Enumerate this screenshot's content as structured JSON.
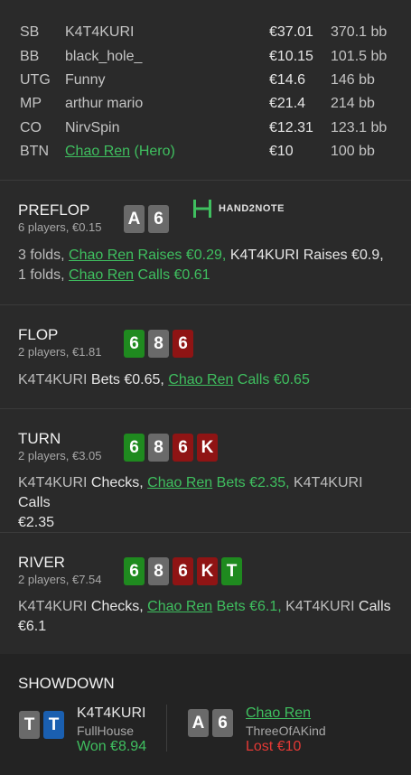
{
  "players": [
    {
      "pos": "SB",
      "name": "K4T4KURI",
      "amount": "€37.01",
      "bb": "370.1 bb"
    },
    {
      "pos": "BB",
      "name": "black_hole_",
      "amount": "€10.15",
      "bb": "101.5 bb"
    },
    {
      "pos": "UTG",
      "name": "Funny",
      "amount": "€14.6",
      "bb": "146 bb"
    },
    {
      "pos": "MP",
      "name": "arthur mario",
      "amount": "€21.4",
      "bb": "214 bb"
    },
    {
      "pos": "CO",
      "name": "NirvSpin",
      "amount": "€12.31",
      "bb": "123.1 bb"
    },
    {
      "pos": "BTN",
      "name": "Chao Ren",
      "hero_tag": "(Hero)",
      "amount": "€10",
      "bb": "100 bb"
    }
  ],
  "logo": {
    "text": "HAND2NOTE"
  },
  "preflop": {
    "title": "PREFLOP",
    "sub": "6 players, €0.15",
    "cards": [
      "A",
      "6"
    ],
    "actions": {
      "a1": "3 folds, ",
      "hero1": "Chao Ren",
      "a2": " Raises €0.29, ",
      "v1": "K4T4KURI",
      "a3": " Raises €0.9, ",
      "a4": "1 folds, ",
      "hero2": "Chao Ren",
      "a5": " Calls €0.61"
    }
  },
  "flop": {
    "title": "FLOP",
    "sub": "2 players, €1.81",
    "cards": [
      "6",
      "8",
      "6"
    ],
    "actions": {
      "v1": "K4T4KURI",
      "a1": " Bets €0.65, ",
      "hero1": "Chao Ren",
      "a2": " Calls €0.65"
    }
  },
  "turn": {
    "title": "TURN",
    "sub": "2 players, €3.05",
    "cards": [
      "6",
      "8",
      "6",
      "K"
    ],
    "actions": {
      "v1": "K4T4KURI",
      "a1": " Checks, ",
      "hero1": "Chao Ren",
      "a2": " Bets €2.35, ",
      "v2": "K4T4KURI",
      "a3": " Calls",
      "a4": "€2.35"
    }
  },
  "river": {
    "title": "RIVER",
    "sub": "2 players, €7.54",
    "cards": [
      "6",
      "8",
      "6",
      "K",
      "T"
    ],
    "actions": {
      "v1": "K4T4KURI",
      "a1": " Checks, ",
      "hero1": "Chao Ren",
      "a2": " Bets €6.1, ",
      "v2": "K4T4KURI",
      "a3": " Calls",
      "a4": "€6.1"
    }
  },
  "showdown": {
    "title": "SHOWDOWN",
    "villain": {
      "name": "K4T4KURI",
      "hand": "FullHouse",
      "result": "Won €8.94",
      "cards": [
        "T",
        "T"
      ]
    },
    "hero": {
      "name": "Chao Ren",
      "hand": "ThreeOfAKind",
      "result": "Lost €10",
      "cards": [
        "A",
        "6"
      ]
    }
  },
  "colors": {
    "hero": "#3fbf5f",
    "won": "#3fbf5f",
    "lost": "#e53935",
    "spade": "#6a6a6a",
    "club": "#1f8a1f",
    "heart": "#8f1414",
    "diamond": "#1a5fb0"
  }
}
